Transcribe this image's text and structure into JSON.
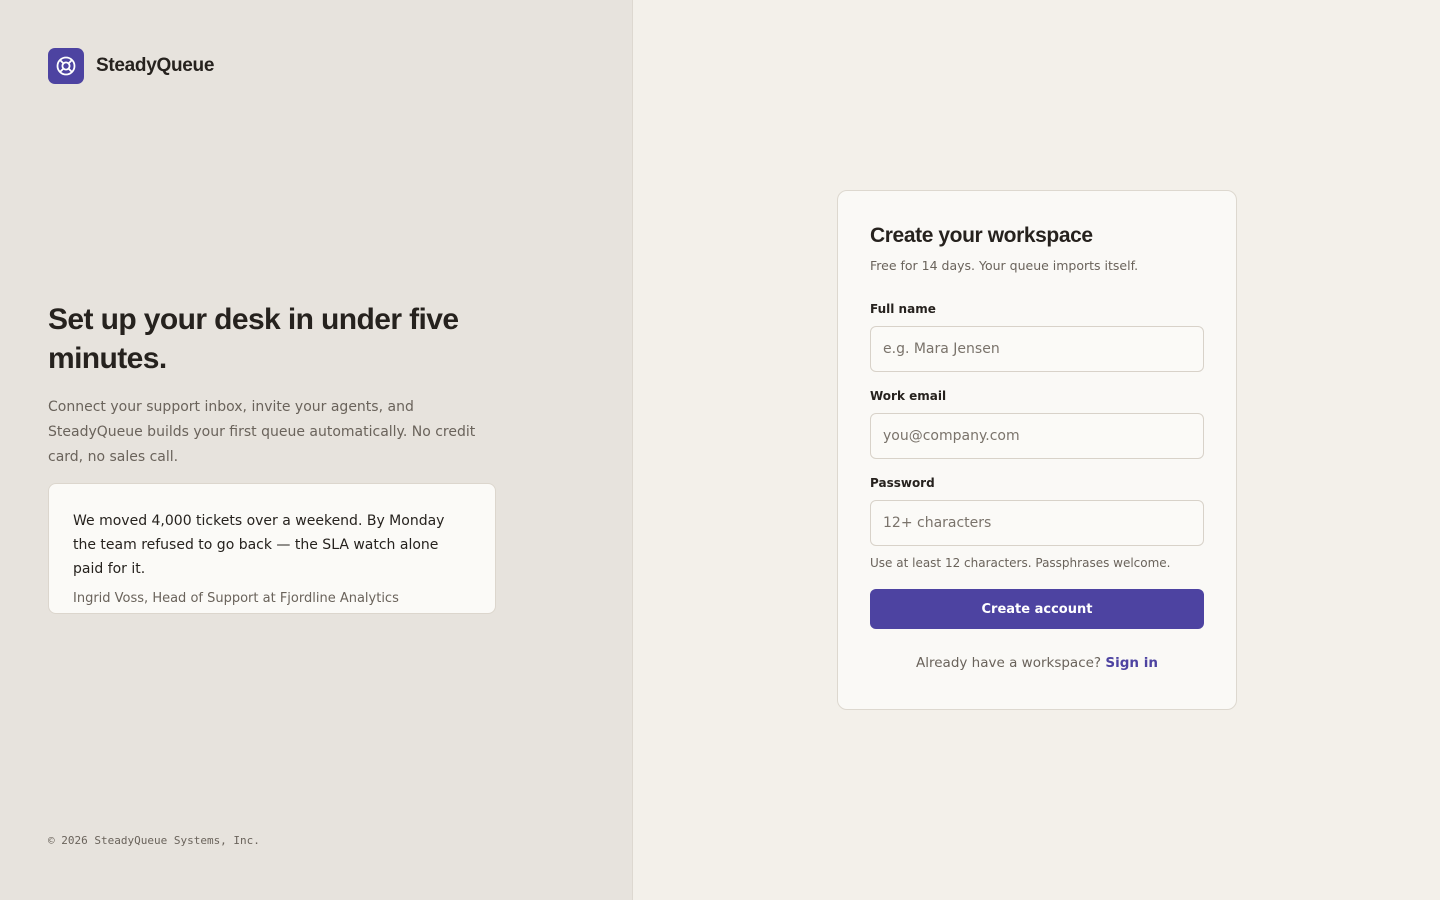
{
  "brand": {
    "name": "SteadyQueue",
    "icon": "lifebuoy-icon",
    "color": "#4d43a1"
  },
  "hero": {
    "title": "Set up your desk in under five minutes.",
    "subtitle": "Connect your support inbox, invite your agents, and SteadyQueue builds your first queue automatically. No credit card, no sales call."
  },
  "testimonial": {
    "quote": "We moved 4,000 tickets over a weekend. By Monday the team refused to go back — the SLA watch alone paid for it.",
    "author": "Ingrid Voss, Head of Support at Fjordline Analytics"
  },
  "footer": {
    "copyright": "© 2026 SteadyQueue Systems, Inc."
  },
  "signup": {
    "title": "Create your workspace",
    "subtitle": "Free for 14 days. Your queue imports itself.",
    "full_name": {
      "label": "Full name",
      "value": "",
      "placeholder": "e.g. Mara Jensen"
    },
    "email": {
      "label": "Work email",
      "value": "",
      "placeholder": "you@company.com"
    },
    "password": {
      "label": "Password",
      "value": "",
      "placeholder": "12+ characters",
      "hint": "Use at least 12 characters. Passphrases welcome."
    },
    "submit_label": "Create account",
    "signin_prompt": "Already have a workspace?",
    "signin_link": "Sign in"
  },
  "colors": {
    "accent": "#4d43a1",
    "left_panel_bg": "#e7e3dd",
    "right_panel_bg": "#f3f0ea"
  }
}
